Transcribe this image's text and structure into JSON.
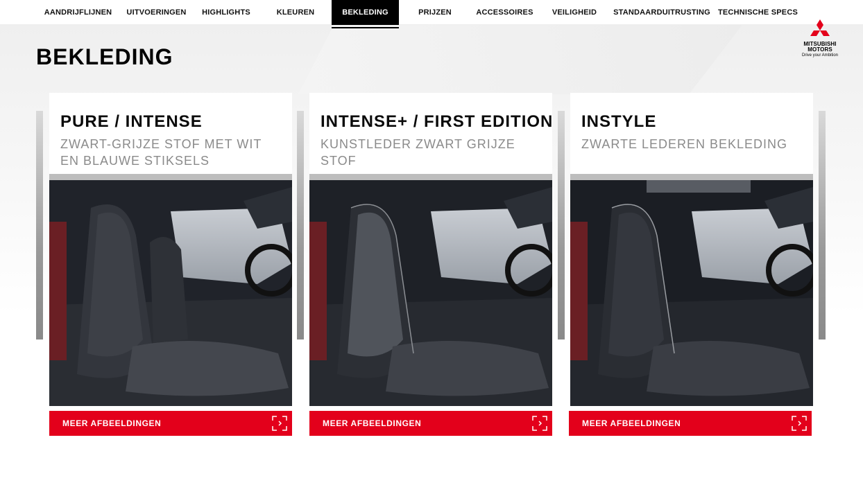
{
  "nav": {
    "items": [
      {
        "label": "AANDRIJFLIJNEN",
        "active": false
      },
      {
        "label": "UITVOERINGEN",
        "active": false
      },
      {
        "label": "HIGHLIGHTS",
        "active": false
      },
      {
        "label": "KLEUREN",
        "active": false
      },
      {
        "label": "BEKLEDING",
        "active": true
      },
      {
        "label": "PRIJZEN",
        "active": false
      },
      {
        "label": "ACCESSOIRES",
        "active": false
      },
      {
        "label": "VEILIGHEID",
        "active": false
      },
      {
        "label": "STANDAARDUITRUSTING",
        "active": false
      },
      {
        "label": "TECHNISCHE SPECS",
        "active": false
      }
    ]
  },
  "logo": {
    "line1": "MITSUBISHI",
    "line2": "MOTORS",
    "tagline": "Drive your Ambition",
    "icon": "three-diamonds-icon"
  },
  "page": {
    "title": "BEKLEDING"
  },
  "cards": [
    {
      "title": "PURE / INTENSE",
      "subtitle": "ZWART-GRIJZE STOF MET WIT EN BLAUWE STIKSELS",
      "button_label": "MEER AFBEELDINGEN"
    },
    {
      "title": "INTENSE+ / FIRST EDITION",
      "subtitle": "KUNSTLEDER ZWART GRIJZE STOF",
      "button_label": "MEER AFBEELDINGEN"
    },
    {
      "title": "INSTYLE",
      "subtitle": "ZWARTE LEDEREN BEKLEDING",
      "button_label": "MEER AFBEELDINGEN"
    }
  ],
  "colors": {
    "accent_red": "#e3001b",
    "active_nav_bg": "#000000",
    "subtitle_gray": "#8a8a8a"
  }
}
